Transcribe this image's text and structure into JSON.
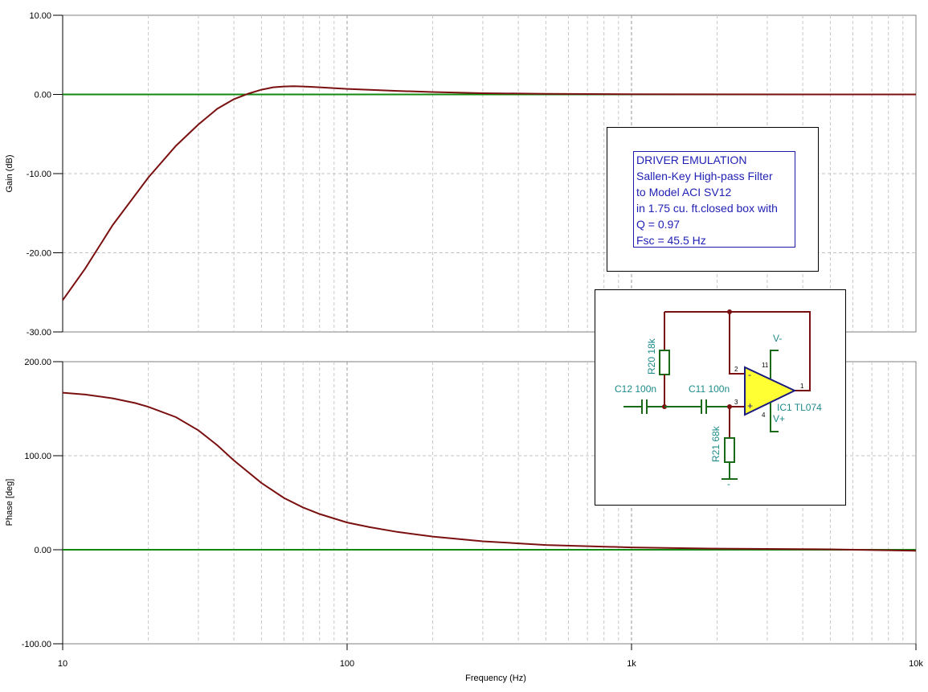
{
  "chart_data": [
    {
      "type": "line",
      "xscale": "log",
      "xlim": [
        10,
        10000
      ],
      "ylim": [
        -30,
        10
      ],
      "ylabel": "Gain (dB)",
      "xlabel": "",
      "y_ticks": [
        "10.00",
        "0.00",
        "-10.00",
        "-20.00",
        "-30.00"
      ],
      "y_tick_values": [
        10,
        0,
        -10,
        -20,
        -30
      ],
      "grid": true,
      "series": [
        {
          "color": "#7a1010",
          "x": [
            10,
            12,
            15,
            20,
            25,
            30,
            35,
            40,
            45,
            50,
            55,
            60,
            65,
            70,
            80,
            100,
            150,
            200,
            300,
            500,
            1000,
            2000,
            5000,
            10000
          ],
          "y": [
            -26.0,
            -22.0,
            -16.5,
            -10.5,
            -6.5,
            -3.8,
            -1.8,
            -0.6,
            0.1,
            0.6,
            0.9,
            1.0,
            1.05,
            1.0,
            0.9,
            0.7,
            0.45,
            0.3,
            0.15,
            0.08,
            0.03,
            0.01,
            0.0,
            0.0
          ]
        },
        {
          "color": "#128a12",
          "x": [
            10,
            10000
          ],
          "y": [
            0,
            0
          ]
        }
      ]
    },
    {
      "type": "line",
      "xscale": "log",
      "xlim": [
        10,
        10000
      ],
      "ylim": [
        -100,
        200
      ],
      "ylabel": "Phase [deg]",
      "xlabel": "Frequency (Hz)",
      "x_ticks": [
        "10",
        "100",
        "1k",
        "10k"
      ],
      "x_tick_values": [
        10,
        100,
        1000,
        10000
      ],
      "y_ticks": [
        "200.00",
        "100.00",
        "0.00",
        "-100.00"
      ],
      "y_tick_values": [
        200,
        100,
        0,
        -100
      ],
      "grid": true,
      "series": [
        {
          "color": "#7a1010",
          "x": [
            10,
            12,
            15,
            18,
            20,
            25,
            30,
            35,
            40,
            50,
            60,
            70,
            80,
            100,
            120,
            150,
            200,
            300,
            500,
            1000,
            2000,
            5000,
            10000
          ],
          "y": [
            167,
            165,
            161,
            156,
            152,
            141,
            127,
            111,
            95,
            71,
            55,
            45,
            38,
            29,
            24,
            19,
            14,
            9,
            5,
            2.5,
            1.2,
            0.4,
            -1
          ]
        },
        {
          "color": "#128a12",
          "x": [
            10,
            10000
          ],
          "y": [
            0,
            0
          ]
        }
      ]
    }
  ],
  "note": {
    "lines": [
      "DRIVER EMULATION",
      "Sallen-Key High-pass Filter",
      "to Model ACI SV12",
      "in 1.75 cu. ft.closed box with",
      "Q = 0.97",
      "Fsc = 45.5 Hz"
    ]
  },
  "schematic": {
    "r20": "R20 18k",
    "r21": "R21 68k",
    "c12": "C12 100n",
    "c11": "C11 100n",
    "ic1": "IC1 TL074",
    "vminus": "V-",
    "vplus": "V+",
    "pins": [
      "2",
      "3",
      "1",
      "11",
      "4"
    ],
    "pin_signs": [
      "-",
      "+"
    ],
    "ground": "-"
  }
}
